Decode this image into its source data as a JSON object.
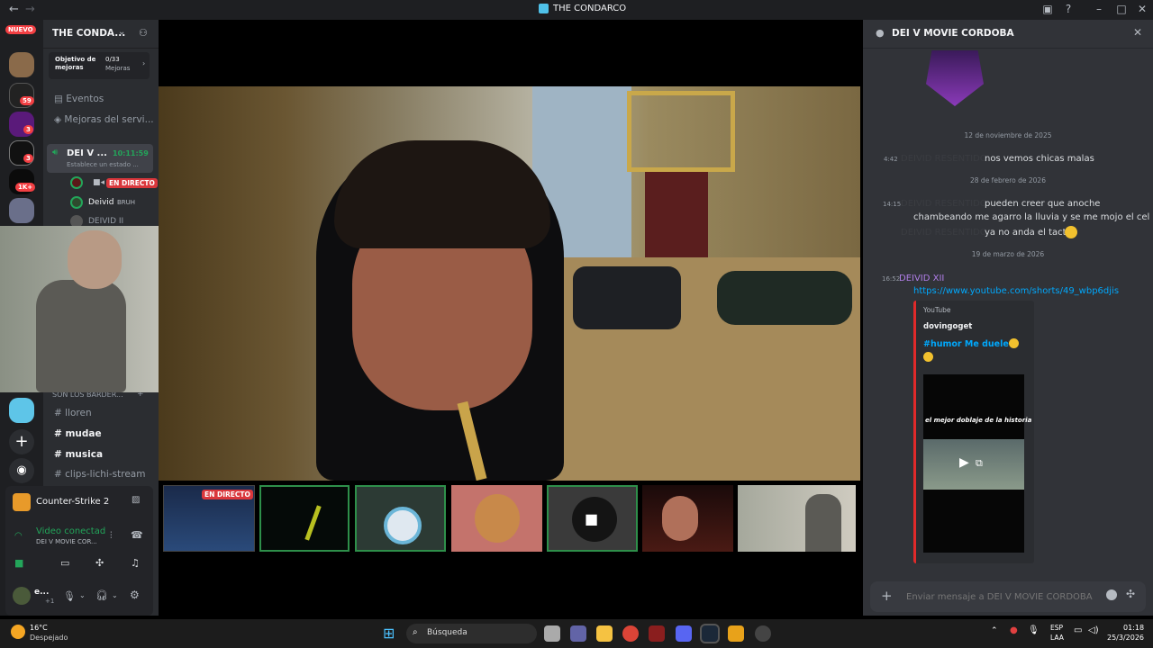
{
  "window": {
    "title": "THE CONDARCO",
    "back": "←",
    "forward": "→"
  },
  "rail": {
    "new_label": "NUEVO",
    "badges": [
      "59",
      "3",
      "3",
      "1K+"
    ]
  },
  "channels": {
    "server_name": "THE CONDA...",
    "boost_title": "Objetivo de mejoras",
    "boost_count": "0/33",
    "boost_unit": "Mejoras",
    "events": "Eventos",
    "boosts": "Mejoras del servi...",
    "voice_channel": "DEI V ...",
    "voice_timer": "10:11:59",
    "voice_status": "Establece un estado ...",
    "live_badge": "EN DIRECTO",
    "users": [
      "Deivid",
      "DEIVID II"
    ],
    "user_tag": "BRUH",
    "category": "SON LOS BARDER...",
    "text_channels": [
      "lloren",
      "mudae",
      "musica",
      "clips-lichi-stream"
    ]
  },
  "activity": {
    "game": "Counter-Strike 2",
    "voice_status": "Video conectad",
    "voice_channel": "DEI V MOVIE COR...",
    "user": "e...",
    "user_sub": "+1"
  },
  "stage": {
    "thumb_live": "EN DIRECTO"
  },
  "chat": {
    "channel_title": "DEI V MOVIE CORDOBA",
    "date1": "12 de noviembre de 2025",
    "msg1_time": "4:42",
    "msg1_author": "DEIVID RESENTIDO",
    "msg1_text": "nos vemos chicas malas",
    "date2": "28 de febrero de 2026",
    "msg2_time": "14:15",
    "msg2_author": "DEIVID RESENTIDO",
    "msg2_line1": "pueden creer que anoche",
    "msg2_line2": "chambeando me agarro la lluvia y se me mojo el cel",
    "msg2_author2": "DEIVID RESENTIDO",
    "msg2_line3": "ya no anda el tactil",
    "date3": "19 de marzo de 2026",
    "msg3_time": "16:52",
    "msg3_author": "DEIVID XII",
    "msg3_link": "https://www.youtube.com/shorts/49_wbp6djis",
    "embed_provider": "YouTube",
    "embed_author": "dovingoget",
    "embed_title": "#humor Me duele",
    "video_caption": "el mejor doblaje de la historia",
    "input_placeholder": "Enviar mensaje a DEI V MOVIE CORDOBA"
  },
  "taskbar": {
    "temp": "16°C",
    "weather": "Despejado",
    "search_placeholder": "Búsqueda",
    "lang1": "ESP",
    "lang2": "LAA",
    "time": "01:18",
    "date": "25/3/2026"
  },
  "colors": {
    "accent": "#5865f2",
    "live": "#da373c",
    "online": "#23a55a",
    "link": "#00a8fc",
    "dark": "#1e1f22"
  }
}
